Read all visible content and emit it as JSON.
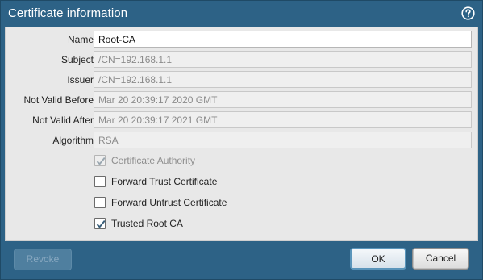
{
  "dialog": {
    "title": "Certificate information",
    "help_icon": "help-circle-icon"
  },
  "fields": [
    {
      "label": "Name",
      "value": "Root-CA",
      "editable": true
    },
    {
      "label": "Subject",
      "value": "/CN=192.168.1.1",
      "editable": false
    },
    {
      "label": "Issuer",
      "value": "/CN=192.168.1.1",
      "editable": false
    },
    {
      "label": "Not Valid Before",
      "value": "Mar 20 20:39:17 2020 GMT",
      "editable": false
    },
    {
      "label": "Not Valid After",
      "value": "Mar 20 20:39:17 2021 GMT",
      "editable": false
    },
    {
      "label": "Algorithm",
      "value": "RSA",
      "editable": false
    }
  ],
  "checkboxes": [
    {
      "label": "Certificate Authority",
      "checked": true,
      "disabled": true
    },
    {
      "label": "Forward Trust Certificate",
      "checked": false,
      "disabled": false
    },
    {
      "label": "Forward Untrust Certificate",
      "checked": false,
      "disabled": false
    },
    {
      "label": "Trusted Root CA",
      "checked": true,
      "disabled": false
    }
  ],
  "buttons": {
    "revoke": "Revoke",
    "ok": "OK",
    "cancel": "Cancel"
  },
  "colors": {
    "frame": "#2d6286",
    "panel": "#e8e8e8"
  }
}
